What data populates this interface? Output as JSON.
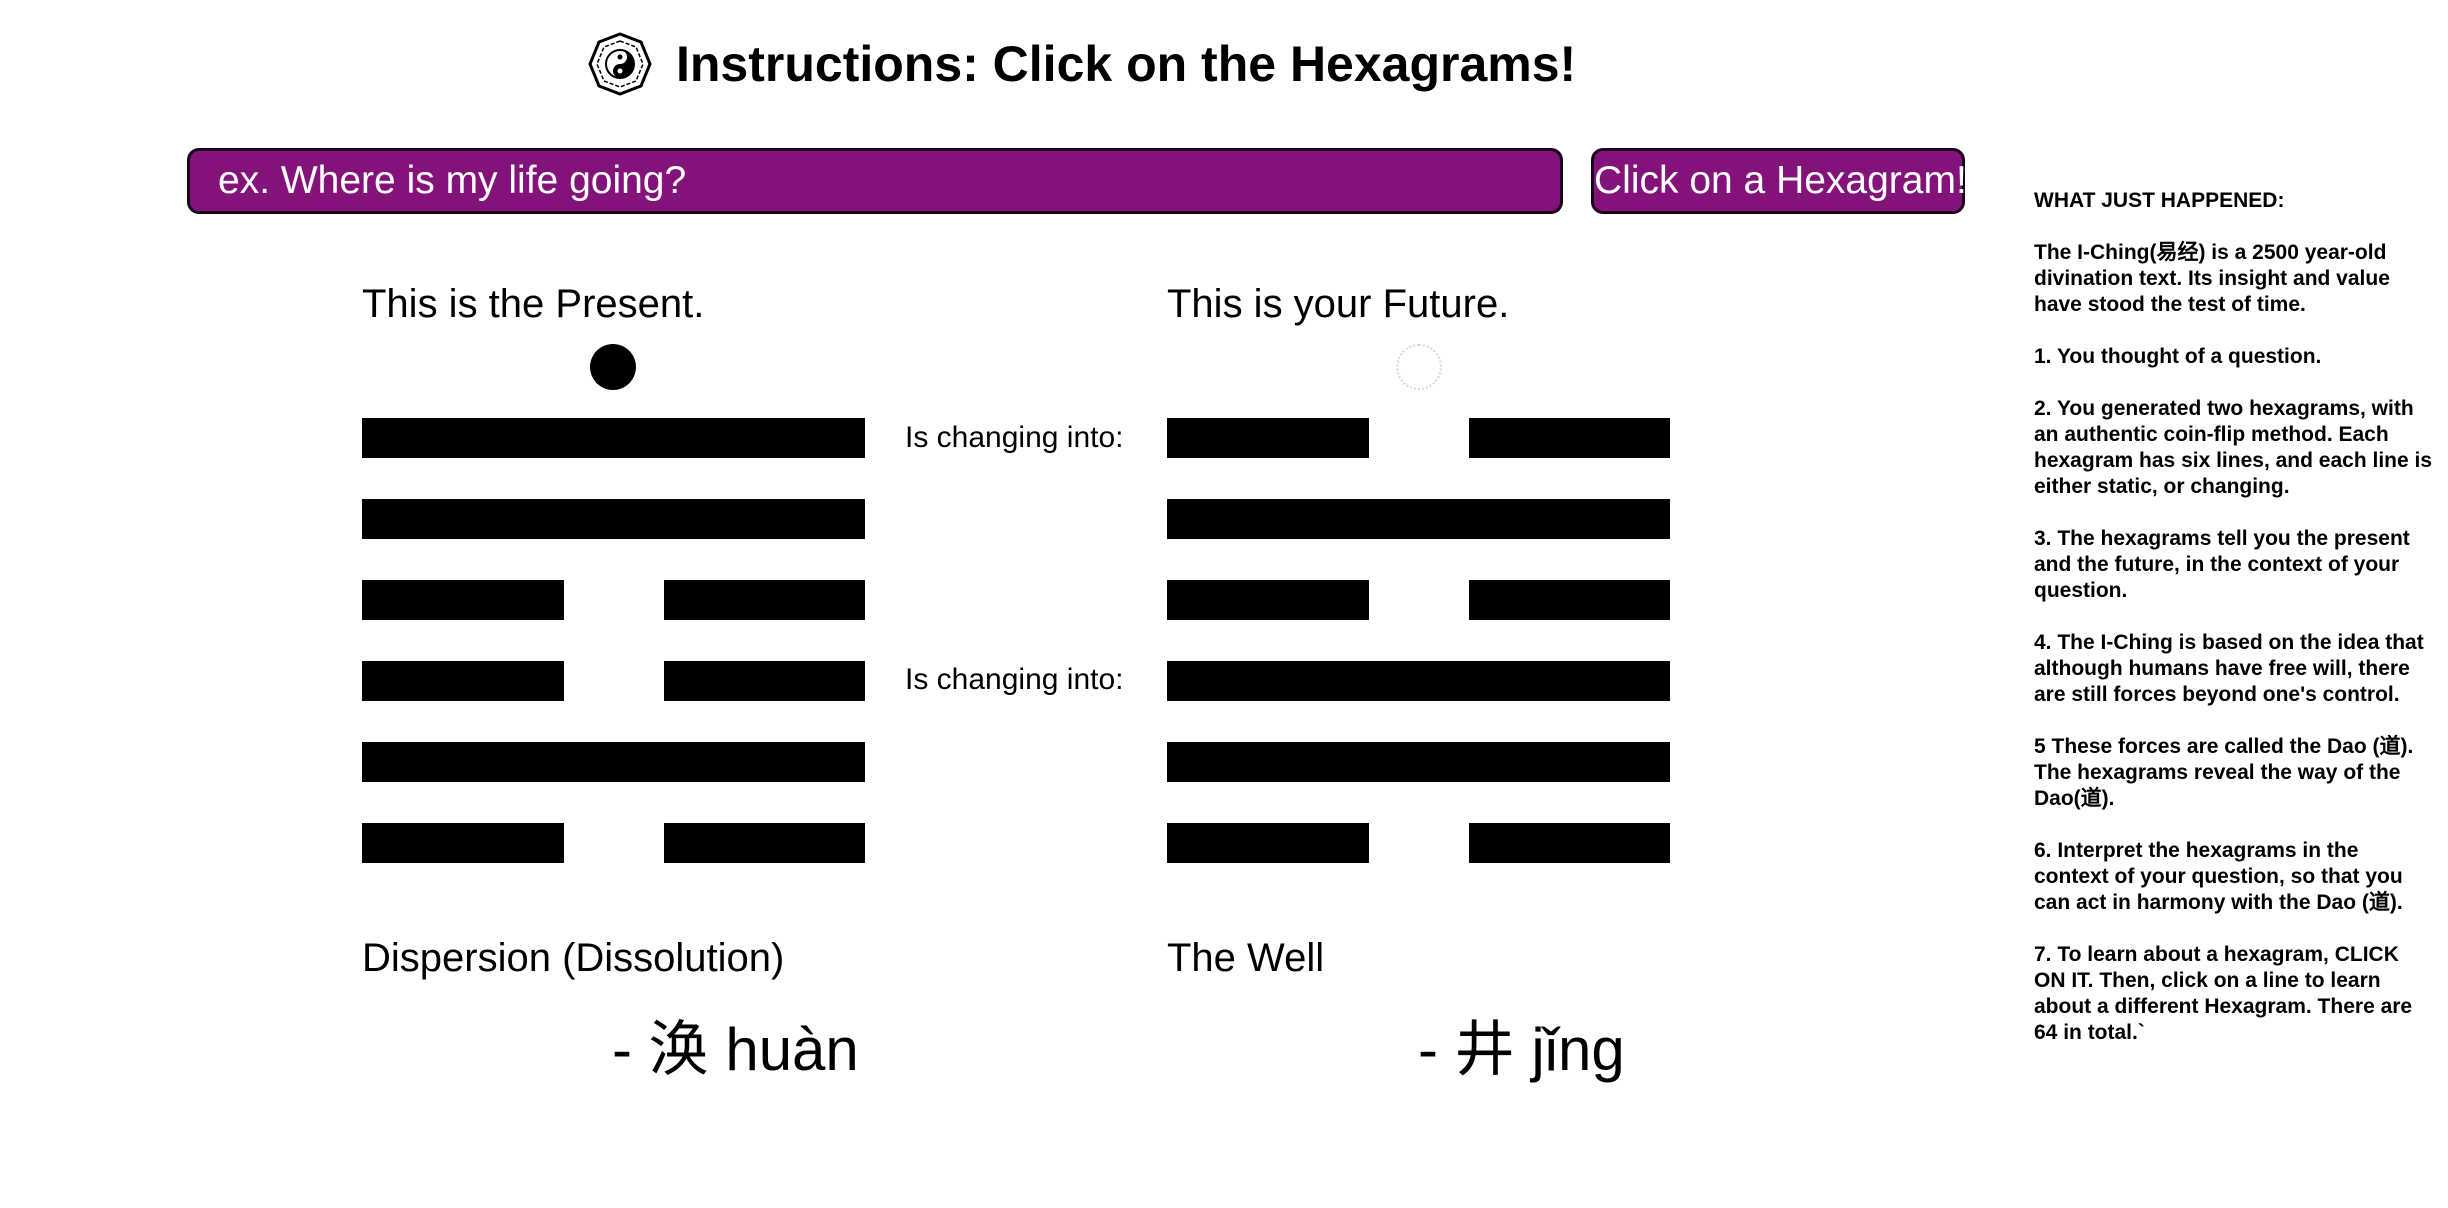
{
  "header": {
    "title": "Instructions: Click on the Hexagrams!",
    "logo_icon": "bagua-yin-yang-icon"
  },
  "question": {
    "placeholder": "ex. Where is my life going?",
    "value": ""
  },
  "hexagram_button": {
    "label": "Click on a Hexagram!"
  },
  "colors": {
    "accent": "#83137a",
    "line": "#000000"
  },
  "present": {
    "caption": "This is the Present.",
    "lines_top_to_bottom": [
      "solid",
      "solid",
      "broken",
      "broken",
      "solid",
      "broken"
    ],
    "changing_lines_top_to_bottom": [
      1
    ],
    "name": "Dispersion (Dissolution)",
    "chinese": "- 涣 huàn"
  },
  "future": {
    "caption": "This is your Future.",
    "lines_top_to_bottom": [
      "broken",
      "solid",
      "broken",
      "solid",
      "solid",
      "broken"
    ],
    "name": "The Well",
    "chinese": "- 井 jǐng"
  },
  "changing_label": "Is changing into:",
  "sidebar": {
    "heading": "WHAT JUST HAPPENED:",
    "paragraphs": [
      "The I-Ching(易经) is a 2500 year-old divination text. Its insight and value have stood the test of time.",
      "1. You thought of a question.",
      "2. You generated two hexagrams, with an authentic coin-flip method. Each hexagram has six lines, and each line is either static, or changing.",
      "3. The hexagrams tell you the present and the future, in the context of your question.",
      "4. The I-Ching is based on the idea that although humans have free will, there are still forces beyond one's control.",
      "5 These forces are called the Dao (道). The hexagrams reveal the way of the Dao(道).",
      "6. Interpret the hexagrams in the context of your question, so that you can act in harmony with the Dao (道).",
      "7. To learn about a hexagram, CLICK ON IT. Then, click on a line to learn about a different Hexagram. There are 64 in total.`"
    ]
  }
}
